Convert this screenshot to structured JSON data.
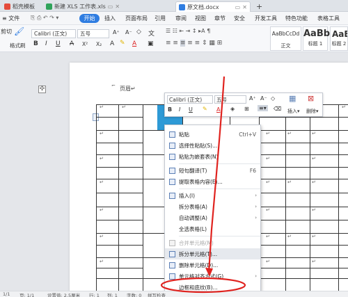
{
  "tabs": {
    "t1": "稻壳模板",
    "t2": "新建 XLS 工作表.xls",
    "t3": "原文档.docx",
    "new_tab": "+"
  },
  "menu": {
    "file": "≡ 文件",
    "start": "开始",
    "insert": "插入",
    "page_layout": "页面布局",
    "reference": "引用",
    "review": "审阅",
    "view": "视图",
    "chapter": "章节",
    "security": "安全",
    "dev": "开发工具",
    "special": "特色功能",
    "table_tools": "表格工具"
  },
  "ribbon": {
    "cut": "剪切",
    "format_painter": "格式刷",
    "font_name": "Calibri (正文)",
    "font_size": "五号",
    "grow": "A⁺",
    "shrink": "A⁻",
    "bold": "B",
    "italic": "I",
    "underline": "U",
    "strike": "A",
    "sup": "X²",
    "sub": "X₂",
    "style_normal_sample": "AaBbCcDd",
    "style_normal_label": "正文",
    "style_h1_sample": "AaBb",
    "style_h1_label": "标题 1",
    "style_h2_sample": "AaBb",
    "style_h2_label": "标题 2"
  },
  "page": {
    "header": "页眉↵",
    "return_mark": "↵"
  },
  "mini_toolbar": {
    "font": "Calibri (正文)",
    "size": "五号",
    "grow": "A⁺",
    "shrink": "A⁻",
    "bold": "B",
    "italic": "I",
    "underline": "U",
    "insert": "插入▾",
    "delete": "删除▾"
  },
  "context_menu": {
    "items": [
      {
        "label": "粘贴",
        "shortcut": "Ctrl+V"
      },
      {
        "label": "选择性粘贴(S)..."
      },
      {
        "label": "粘贴为嵌套表(N)"
      },
      {
        "label": "短句翻译(T)",
        "shortcut": "F6"
      },
      {
        "label": "提取表格内容(E)..."
      },
      {
        "label": "插入(I)"
      },
      {
        "label": "拆分表格(A)"
      },
      {
        "label": "自动调整(A)"
      },
      {
        "label": "全选表格(L)"
      },
      {
        "label": "合并单元格(M)"
      },
      {
        "label": "拆分单元格(T)..."
      },
      {
        "label": "删除单元格(D)..."
      },
      {
        "label": "单元格对齐方式(G)"
      },
      {
        "label": "边框和底纹(B)..."
      }
    ]
  },
  "status": {
    "page": "1/1",
    "page_of": "页: 1/1",
    "pos": "设置值: 2.5厘米",
    "line": "行: 1",
    "col": "列: 1",
    "words": "字数: 0",
    "spell": "拼写检查"
  },
  "colors": {
    "accent": "#2f7de1",
    "selection": "#2e9ad6",
    "annotation": "#e0231f"
  }
}
